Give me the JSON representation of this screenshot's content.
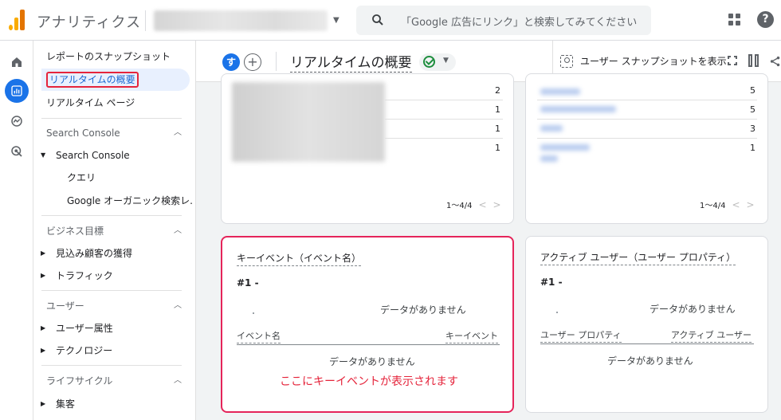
{
  "app": {
    "title": "アナリティクス"
  },
  "search": {
    "placeholder": "「Google 広告にリンク」と検索してみてください"
  },
  "header_icons": [
    "search-icon",
    "apps-icon",
    "help-icon"
  ],
  "sidebar": {
    "items": [
      {
        "label": "レポートのスナップショット"
      },
      {
        "label": "リアルタイムの概要",
        "selected": true
      },
      {
        "label": "リアルタイム ページ"
      }
    ],
    "sections": [
      {
        "label": "Search Console",
        "expanded": true,
        "groups": [
          {
            "label": "Search Console",
            "expanded": true,
            "children": [
              {
                "label": "クエリ"
              },
              {
                "label": "Google オーガニック検索レ..."
              }
            ]
          }
        ]
      },
      {
        "label": "ビジネス目標",
        "expanded": true,
        "groups": [
          {
            "label": "見込み顧客の獲得"
          },
          {
            "label": "トラフィック"
          }
        ]
      },
      {
        "label": "ユーザー",
        "expanded": true,
        "groups": [
          {
            "label": "ユーザー属性"
          },
          {
            "label": "テクノロジー"
          }
        ]
      },
      {
        "label": "ライフサイクル",
        "expanded": true,
        "groups": [
          {
            "label": "集客"
          }
        ]
      }
    ]
  },
  "main": {
    "avatar_letter": "す",
    "add_label": "+",
    "title": "リアルタイムの概要",
    "snapshot_label": "ユーザー スナップショットを表示"
  },
  "cards": {
    "top_left": {
      "values": [
        "2",
        "1",
        "1",
        "1"
      ],
      "pager": "1〜4/4"
    },
    "top_right": {
      "values": [
        "5",
        "5",
        "3",
        "1"
      ],
      "pager": "1〜4/4"
    },
    "key_event": {
      "title": "キーイベント（イベント名）",
      "rank": "#1 -",
      "no_data_top": "データがありません",
      "col_left": "イベント名",
      "col_right": "キーイベント",
      "no_data_table": "データがありません",
      "callout": "ここにキーイベントが表示されます",
      "highlight_color": "#e5243b"
    },
    "active_users": {
      "title": "アクティブ ユーザー（ユーザー プロパティ）",
      "rank": "#1 -",
      "no_data_top": "データがありません",
      "col_left": "ユーザー プロパティ",
      "col_right": "アクティブ ユーザー",
      "no_data_table": "データがありません"
    }
  },
  "colors": {
    "accent": "#1a73e8",
    "highlight": "#e5243b",
    "logo": "#f9ab00"
  }
}
